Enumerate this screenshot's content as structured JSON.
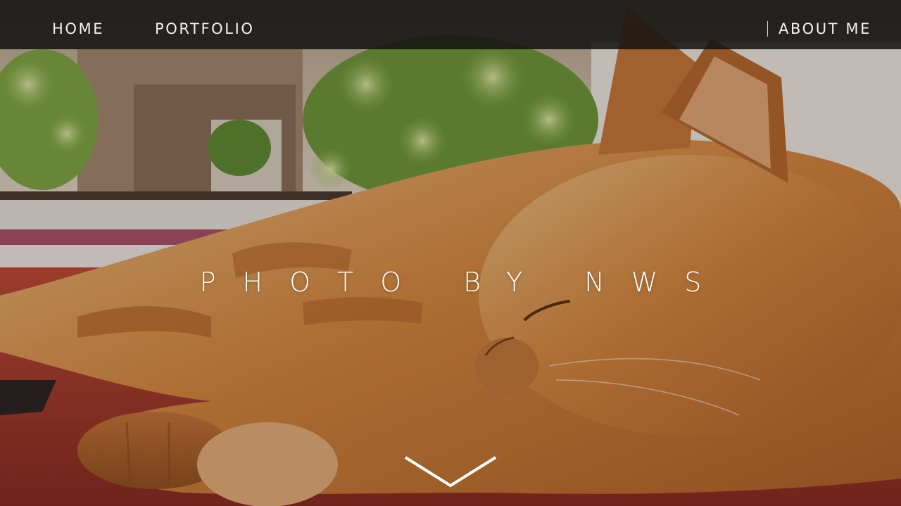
{
  "nav": {
    "home_label": "HOME",
    "portfolio_label": "PORTFOLIO",
    "about_label": "ABOUT ME"
  },
  "hero": {
    "title": "PHOTO BY NWS",
    "scroll_icon": "chevron-down-icon",
    "background_subject": "sleeping orange tabby cat"
  },
  "colors": {
    "nav_background": "#121212",
    "nav_text": "#f2f2f2",
    "hero_text": "#ffffff",
    "cat_fur": "#d9883e",
    "surface": "#b33a2c"
  }
}
